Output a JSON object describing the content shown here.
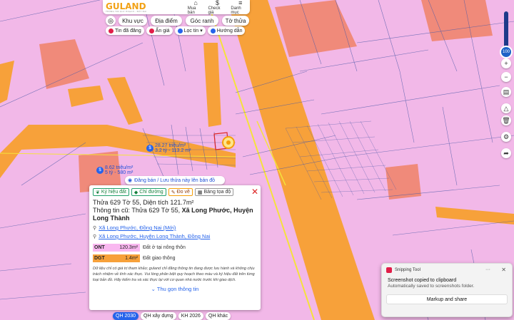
{
  "app": {
    "logo": "GULAND",
    "tagline": "THÔNG TIN QUY HOẠCH - ĐẤT ĐAI",
    "top_buttons": [
      {
        "label": "Mua bán",
        "icon": "house-icon"
      },
      {
        "label": "Check giá",
        "icon": "dollar-icon"
      },
      {
        "label": "Danh mục",
        "icon": "menu-icon"
      }
    ]
  },
  "tabs": [
    "Khu vực",
    "Địa điểm",
    "Góc ranh",
    "Tờ thửa"
  ],
  "filters": [
    {
      "label": "Tin đã đăng",
      "color": "#e11d48"
    },
    {
      "label": "Ẩn giá",
      "color": "#e11d48"
    },
    {
      "label": "Lọc tin",
      "color": "#2563eb"
    },
    {
      "label": "Hướng dẫn",
      "color": "#2563eb"
    }
  ],
  "zoom_level": "100",
  "map_labels": [
    {
      "line1": "28.27 triệu/m²",
      "line2": "3.2 tỷ - 113.2 m²"
    },
    {
      "line1": "8.62 triệu/m²",
      "line2": "5 tỷ - 580 m²"
    }
  ],
  "post_bar": "Đăng bán / Lưu thửa này lên bản đồ",
  "panel": {
    "actions": [
      "Ký hiệu đất",
      "Chỉ đường",
      "Đo vẽ",
      "Bảng tọa độ"
    ],
    "title_line": "Thửa 629 Tờ 55, Diện tích 121.7m²",
    "old_info_prefix": "Thông tin cũ: Thửa 629 Tờ 55, ",
    "old_info_addr": "Xã Long Phước, Huyện Long Thành",
    "address_new": "Xã Long Phước, Đồng Nai (Mới)",
    "address_old": "Xã Long Phước, Huyện Long Thành, Đồng Nai",
    "zones": [
      {
        "code": "ONT",
        "area": "120.3m²",
        "label": "Đất ở tại nông thôn",
        "color": "#f9b8f0"
      },
      {
        "code": "DGT",
        "area": "1.4m²",
        "label": "Đất giao thông",
        "color": "#f7a13a"
      }
    ],
    "disclaimer": "Dữ liệu chỉ có giá trị tham khảo; guland chỉ đăng thông tin đang được lưu hành và không chịu trách nhiệm về tính xác thực. Vui lòng phân biệt quy hoạch theo màu và ký hiệu đất trên từng loại bản đồ. Hãy kiểm tra và xác thực lại với cơ quan nhà nước trước khi giao dịch.",
    "collapse_label": "Thu gọn thông tin"
  },
  "plan_tabs": [
    {
      "label": "QH 2030",
      "active": true
    },
    {
      "label": "QH xây dựng",
      "active": false
    },
    {
      "label": "KH 2026",
      "active": false
    },
    {
      "label": "QH khác",
      "active": false
    }
  ],
  "toast": {
    "app_name": "Snipping Tool",
    "title": "Screenshot copied to clipboard",
    "subtitle": "Automatically saved to screenshots folder.",
    "button": "Markup and share"
  }
}
